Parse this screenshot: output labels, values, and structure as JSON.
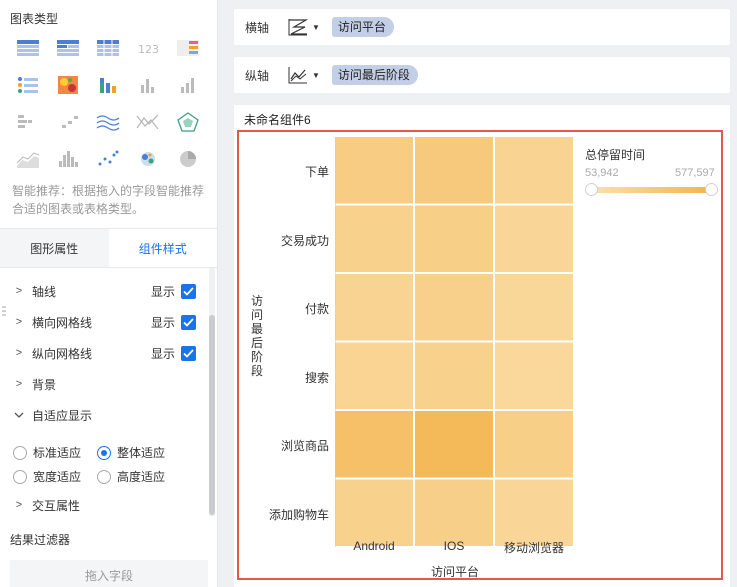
{
  "left_panel": {
    "chart_type_title": "图表类型",
    "chart_icons": [
      "table-icon",
      "pivot-table-icon",
      "cross-table-icon",
      "kpi-number-icon",
      "color-table-icon",
      "list-indicator-icon",
      "heat-grid-icon",
      "stacked-bar-icon",
      "bar-chart-icon",
      "column-chart-icon",
      "grouped-bar-icon",
      "step-bar-icon",
      "multi-line-icon",
      "line-area-icon",
      "radar-icon",
      "area-chart-icon",
      "histogram-icon",
      "scatter-icon",
      "bubble-icon",
      "pie-chart-icon"
    ],
    "hint": "智能推荐：根据拖入的字段智能推荐合适的图表或表格类型。",
    "tabs": [
      {
        "label": "图形属性"
      },
      {
        "label": "组件样式"
      }
    ],
    "props": {
      "axis_line": {
        "label": "轴线",
        "show": "显示"
      },
      "h_grid": {
        "label": "横向网格线",
        "show": "显示"
      },
      "v_grid": {
        "label": "纵向网格线",
        "show": "显示"
      },
      "background": {
        "label": "背景"
      },
      "adaptive": {
        "label": "自适应显示"
      },
      "interaction": {
        "label": "交互属性"
      }
    },
    "radio_options": [
      {
        "label": "标准适应",
        "checked": false
      },
      {
        "label": "整体适应",
        "checked": true
      },
      {
        "label": "宽度适应",
        "checked": false
      },
      {
        "label": "高度适应",
        "checked": false
      }
    ],
    "filter_title": "结果过滤器",
    "drop_zone": "拖入字段"
  },
  "axes": {
    "x": {
      "label": "横轴",
      "field": "访问平台"
    },
    "y": {
      "label": "纵轴",
      "field": "访问最后阶段"
    }
  },
  "component": {
    "title": "未命名组件6",
    "y_axis_title": "访问最后阶段",
    "x_axis_title": "访问平台",
    "legend": {
      "title": "总停留时间",
      "min": "53,942",
      "max": "577,597"
    }
  },
  "chart_data": {
    "type": "heatmap",
    "title": "",
    "xlabel": "访问平台",
    "ylabel": "访问最后阶段",
    "x": [
      "Android",
      "IOS",
      "移动浏览器"
    ],
    "y": [
      "下单",
      "交易成功",
      "付款",
      "搜索",
      "浏览商品",
      "添加购物车"
    ],
    "values": [
      [
        0.42,
        0.5,
        0.28
      ],
      [
        0.32,
        0.38,
        0.22
      ],
      [
        0.28,
        0.34,
        0.2
      ],
      [
        0.27,
        0.32,
        0.18
      ],
      [
        0.7,
        0.85,
        0.38
      ],
      [
        0.32,
        0.36,
        0.22
      ]
    ],
    "color_scale": [
      "#fbe0ad",
      "#f3b24a"
    ],
    "legend_range": [
      "53,942",
      "577,597"
    ],
    "legend_title": "总停留时间"
  }
}
